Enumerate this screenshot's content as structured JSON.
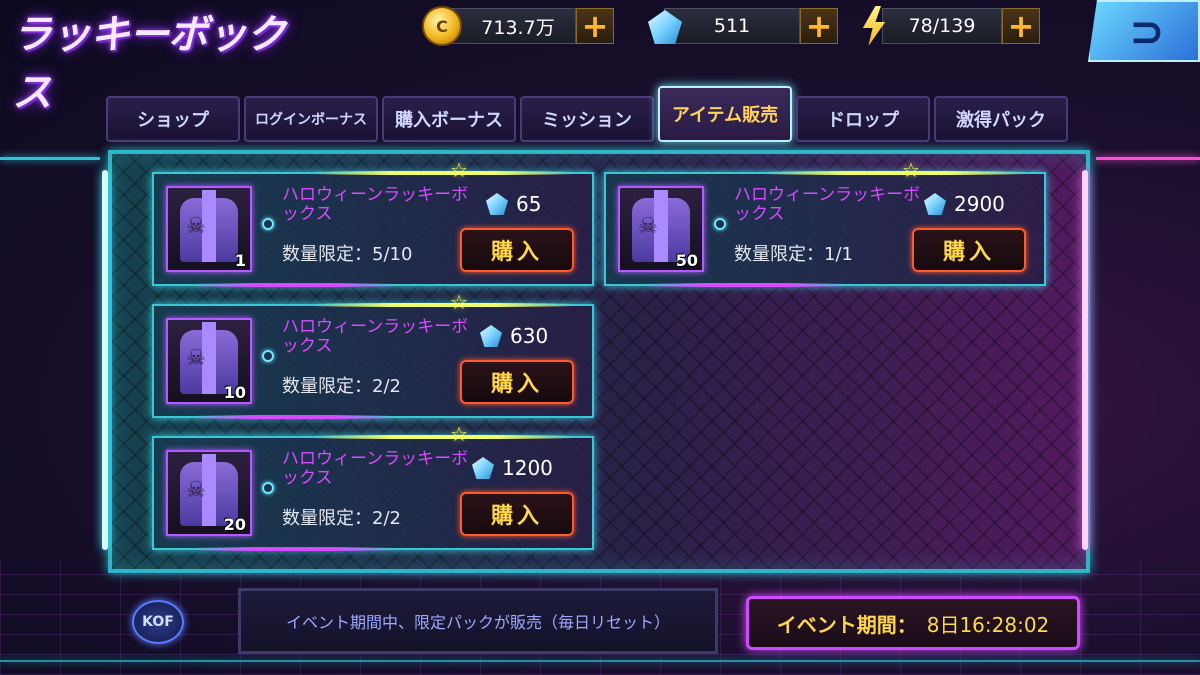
{
  "title": "ラッキーボックス",
  "currency": {
    "coins": "713.7万",
    "gems": "511",
    "stamina": "78/139",
    "plus": "+"
  },
  "back_label": "⊃",
  "tabs": [
    {
      "label": "ショップ"
    },
    {
      "label": "ログインボーナス"
    },
    {
      "label": "購入ボーナス"
    },
    {
      "label": "ミッション"
    },
    {
      "label": "アイテム販売"
    },
    {
      "label": "ドロップ"
    },
    {
      "label": "激得パック"
    }
  ],
  "items": [
    {
      "name": "ハロウィーンラッキーボックス",
      "qty": "1",
      "price": "65",
      "limit": "数量限定：5/10",
      "buy": "購入"
    },
    {
      "name": "ハロウィーンラッキーボックス",
      "qty": "50",
      "price": "2900",
      "limit": "数量限定：1/1",
      "buy": "購入"
    },
    {
      "name": "ハロウィーンラッキーボックス",
      "qty": "10",
      "price": "630",
      "limit": "数量限定：2/2",
      "buy": "購入"
    },
    {
      "name": "ハロウィーンラッキーボックス",
      "qty": "20",
      "price": "1200",
      "limit": "数量限定：2/2",
      "buy": "購入"
    }
  ],
  "kof": "KOF",
  "notice": "イベント期間中、限定パックが販売（毎日リセット）",
  "event": {
    "label": "イベント期間：",
    "time": "8日16:28:02"
  },
  "colors": {
    "accent_cyan": "#39c7d6",
    "accent_magenta": "#d04bff",
    "gold": "#ffd84a"
  }
}
